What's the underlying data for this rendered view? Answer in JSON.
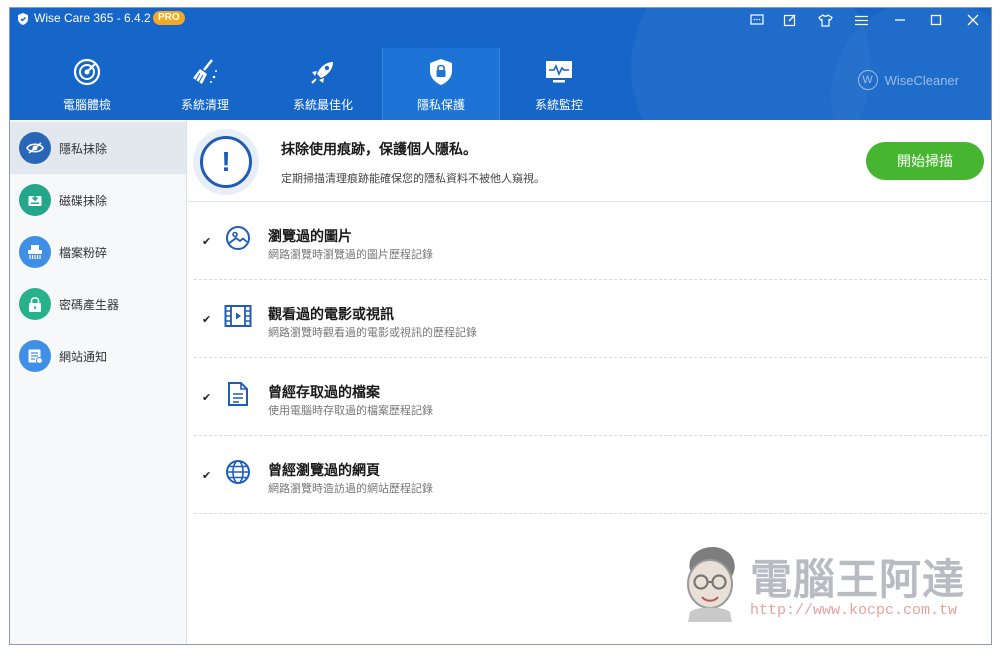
{
  "app": {
    "title": "Wise Care 365 - 6.4.2",
    "badge": "PRO",
    "brand": "WiseCleaner",
    "brand_mark": "W"
  },
  "nav": [
    {
      "label": "電腦體檢",
      "icon": "target-icon"
    },
    {
      "label": "系統清理",
      "icon": "broom-icon"
    },
    {
      "label": "系統最佳化",
      "icon": "rocket-icon"
    },
    {
      "label": "隱私保護",
      "icon": "shield-lock-icon",
      "active": true
    },
    {
      "label": "系統監控",
      "icon": "monitor-pulse-icon"
    }
  ],
  "sidebar": [
    {
      "label": "隱私抹除",
      "icon": "eye-off-icon",
      "color": "#2a66b8",
      "active": true
    },
    {
      "label": "磁碟抹除",
      "icon": "disk-erase-icon",
      "color": "#24a68a"
    },
    {
      "label": "檔案粉碎",
      "icon": "shredder-icon",
      "color": "#3f8fe6"
    },
    {
      "label": "密碼產生器",
      "icon": "password-lock-icon",
      "color": "#27b28b"
    },
    {
      "label": "網站通知",
      "icon": "web-notify-icon",
      "color": "#3f8fe6"
    }
  ],
  "banner": {
    "title": "抹除使用痕跡，保護個人隱私。",
    "subtitle": "定期掃描清理痕跡能確保您的隱私資料不被他人窺視。",
    "icon_glyph": "!",
    "scan_button": "開始掃描"
  },
  "items": [
    {
      "title": "瀏覽過的圖片",
      "desc": "網路瀏覽時瀏覽過的圖片歷程記錄",
      "checked": true,
      "icon": "image-icon"
    },
    {
      "title": "觀看過的電影或視訊",
      "desc": "網路瀏覽時觀看過的電影或視訊的歷程記錄",
      "checked": true,
      "icon": "film-icon"
    },
    {
      "title": "曾經存取過的檔案",
      "desc": "使用電腦時存取過的檔案歷程記錄",
      "checked": true,
      "icon": "document-icon"
    },
    {
      "title": "曾經瀏覽過的網頁",
      "desc": "網路瀏覽時造訪過的網站歷程記錄",
      "checked": true,
      "icon": "globe-icon"
    }
  ],
  "checkmark": "✔",
  "watermark": {
    "text": "電腦王阿達",
    "url": "http://www.kocpc.com.tw"
  },
  "colors": {
    "header": "#1666c9",
    "accent": "#46b52f",
    "alert": "#1e5cb6"
  }
}
